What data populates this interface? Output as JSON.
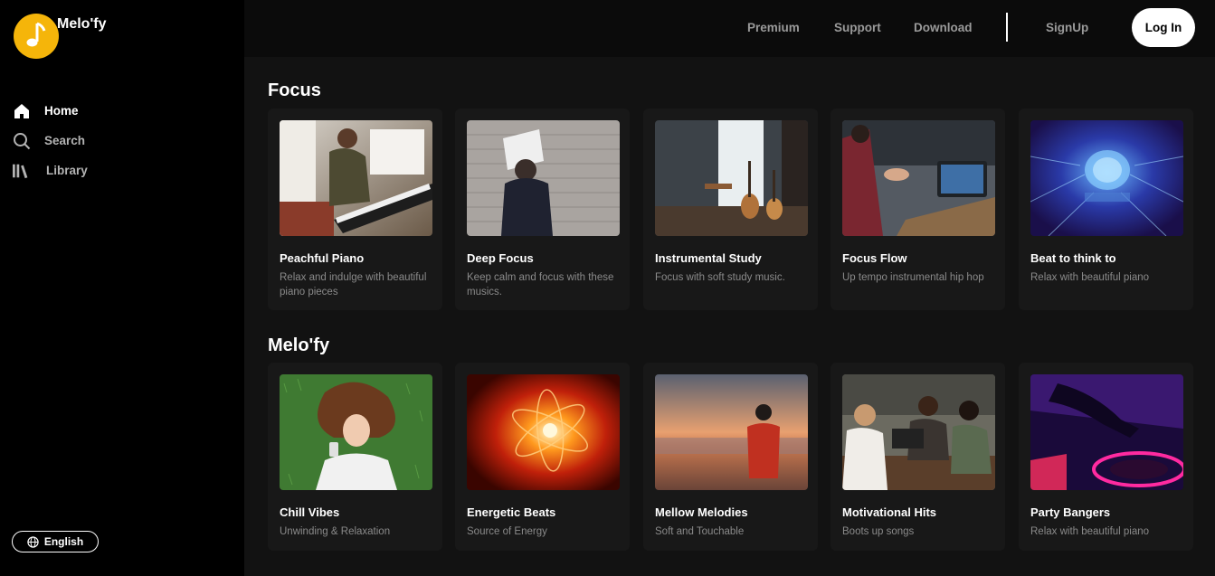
{
  "app": {
    "name": "Melo'fy"
  },
  "sidebar": {
    "items": [
      {
        "label": "Home",
        "icon": "home-icon"
      },
      {
        "label": "Search",
        "icon": "search-icon"
      },
      {
        "label": "Library",
        "icon": "library-icon"
      }
    ],
    "language": "English"
  },
  "topbar": {
    "premium": "Premium",
    "support": "Support",
    "download": "Download",
    "signup": "SignUp",
    "login": "Log In"
  },
  "sections": [
    {
      "title": "Focus",
      "cards": [
        {
          "title": "Peachful Piano",
          "desc": "Relax and indulge with beautiful piano pieces"
        },
        {
          "title": "Deep Focus",
          "desc": "Keep calm and focus with these musics."
        },
        {
          "title": "Instrumental Study",
          "desc": "Focus with soft study music."
        },
        {
          "title": "Focus Flow",
          "desc": "Up tempo instrumental hip hop"
        },
        {
          "title": "Beat to think to",
          "desc": "Relax with beautiful piano"
        }
      ]
    },
    {
      "title": "Melo'fy",
      "cards": [
        {
          "title": "Chill Vibes",
          "desc": "Unwinding & Relaxation"
        },
        {
          "title": "Energetic Beats",
          "desc": "Source of Energy"
        },
        {
          "title": "Mellow Melodies",
          "desc": "Soft and Touchable"
        },
        {
          "title": "Motivational Hits",
          "desc": "Boots up songs"
        },
        {
          "title": "Party Bangers",
          "desc": "Relax with beautiful piano"
        }
      ]
    }
  ],
  "colors": {
    "accent": "#f5b50a",
    "background": "#121212",
    "card": "#181818",
    "sidebar": "#000000"
  }
}
